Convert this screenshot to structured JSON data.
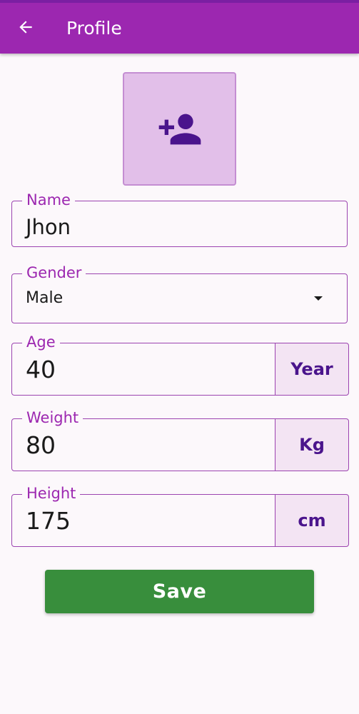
{
  "app_bar": {
    "title": "Profile",
    "back_icon": "arrow-back-icon",
    "color": "#9c27b0"
  },
  "avatar": {
    "icon": "add-person-icon",
    "background": "#e2bfe9",
    "icon_color": "#4a148c"
  },
  "form": {
    "name": {
      "label": "Name",
      "value": "Jhon"
    },
    "gender": {
      "label": "Gender",
      "value": "Male"
    },
    "age": {
      "label": "Age",
      "value": "40",
      "unit": "Year"
    },
    "weight": {
      "label": "Weight",
      "value": "80",
      "unit": "Kg"
    },
    "height": {
      "label": "Height",
      "value": "175",
      "unit": "cm"
    }
  },
  "save_button": {
    "label": "Save",
    "color": "#388e3c"
  }
}
